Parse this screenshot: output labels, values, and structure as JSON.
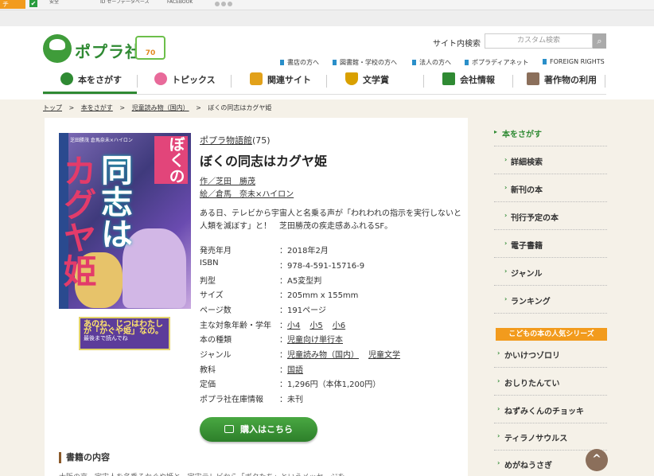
{
  "browser_strip": {
    "tab1": "チ",
    "tab2": "安全",
    "tab3": "ID セーフデータベース",
    "tab4": "FACEBOOK"
  },
  "header": {
    "logo_text": "ポプラ社",
    "badge_text": "70",
    "search_label": "サイト内検索",
    "search_placeholder": "カスタム検索",
    "top_links": [
      "書店の方へ",
      "図書館・学校の方へ",
      "法人の方へ",
      "ポプラディアネット",
      "FOREIGN RIGHTS"
    ],
    "nav": [
      {
        "label": "本をさがす",
        "color": "#2f8a33"
      },
      {
        "label": "トピックス",
        "color": "#e86a9a"
      },
      {
        "label": "関連サイト",
        "color": "#e2a11a"
      },
      {
        "label": "文学賞",
        "color": "#d9a000"
      },
      {
        "label": "会社情報",
        "color": "#2f8a33"
      },
      {
        "label": "著作物の利用",
        "color": "#8b6f5b"
      }
    ]
  },
  "breadcrumb": [
    "トップ",
    ">",
    "本をさがす",
    ">",
    "児童読み物（国内）",
    ">",
    "ぼくの同志はカグヤ姫"
  ],
  "book": {
    "series": "ポプラ物語館",
    "series_no": "(75)",
    "title": "ぼくの同志はカグヤ姫",
    "author": "作／芝田　勝茂",
    "illustrator": "絵／倉馬　奈未×ハイロン",
    "description": "ある日、テレビから宇宙人と名乗る声が「われわれの指示を実行しないと人類を滅ぼす」と！　芝田勝茂の疾走感あふれるSF。",
    "cover_title": "ぼくの同志はカグヤ姫",
    "cover_author": "芝田勝茂 倉馬奈未×ハイロン",
    "banner_line1": "あのね、じつはわたしが「かぐや姫」なの。",
    "banner_line2": "最後まで読んでね",
    "specs": [
      {
        "k": "発売年月",
        "v": "：2018年2月"
      },
      {
        "k": "ISBN",
        "v": "：978-4-591-15716-9"
      },
      {
        "k": "判型",
        "v": "：A5変型判"
      },
      {
        "k": "サイズ",
        "v": "：205mm x 155mm"
      },
      {
        "k": "ページ数",
        "v": "：191ページ"
      },
      {
        "k": "主な対象年齢・学年",
        "v": "：",
        "links": [
          "小4",
          "小5",
          "小6"
        ]
      },
      {
        "k": "本の種類",
        "v": "：",
        "links": [
          "児童向け単行本"
        ]
      },
      {
        "k": "ジャンル",
        "v": "：",
        "links": [
          "児童読み物（国内）",
          "児童文学"
        ]
      },
      {
        "k": "教科",
        "v": "：",
        "links": [
          "国語"
        ]
      },
      {
        "k": "定価",
        "v": "：1,296円（本体1,200円）"
      },
      {
        "k": "ポプラ社在庫情報",
        "v": "：未刊"
      }
    ],
    "buy_label": "購入はこちら",
    "section_title": "書籍の内容",
    "section_text": "大阪の京、宇宙人を名乗るかぐや姫と、宇宙テレビから「ボクたち」というメッセージを"
  },
  "sidebar": {
    "top": "本をさがす",
    "items": [
      "詳細検索",
      "新刊の本",
      "刊行予定の本",
      "電子書籍",
      "ジャンル",
      "ランキング"
    ],
    "series_heading": "こどもの本の人気シリーズ",
    "series": [
      "かいけつゾロリ",
      "おしりたんてい",
      "ねずみくんのチョッキ",
      "ティラノサウルス",
      "めがねうさぎ"
    ]
  },
  "to_top": "^"
}
